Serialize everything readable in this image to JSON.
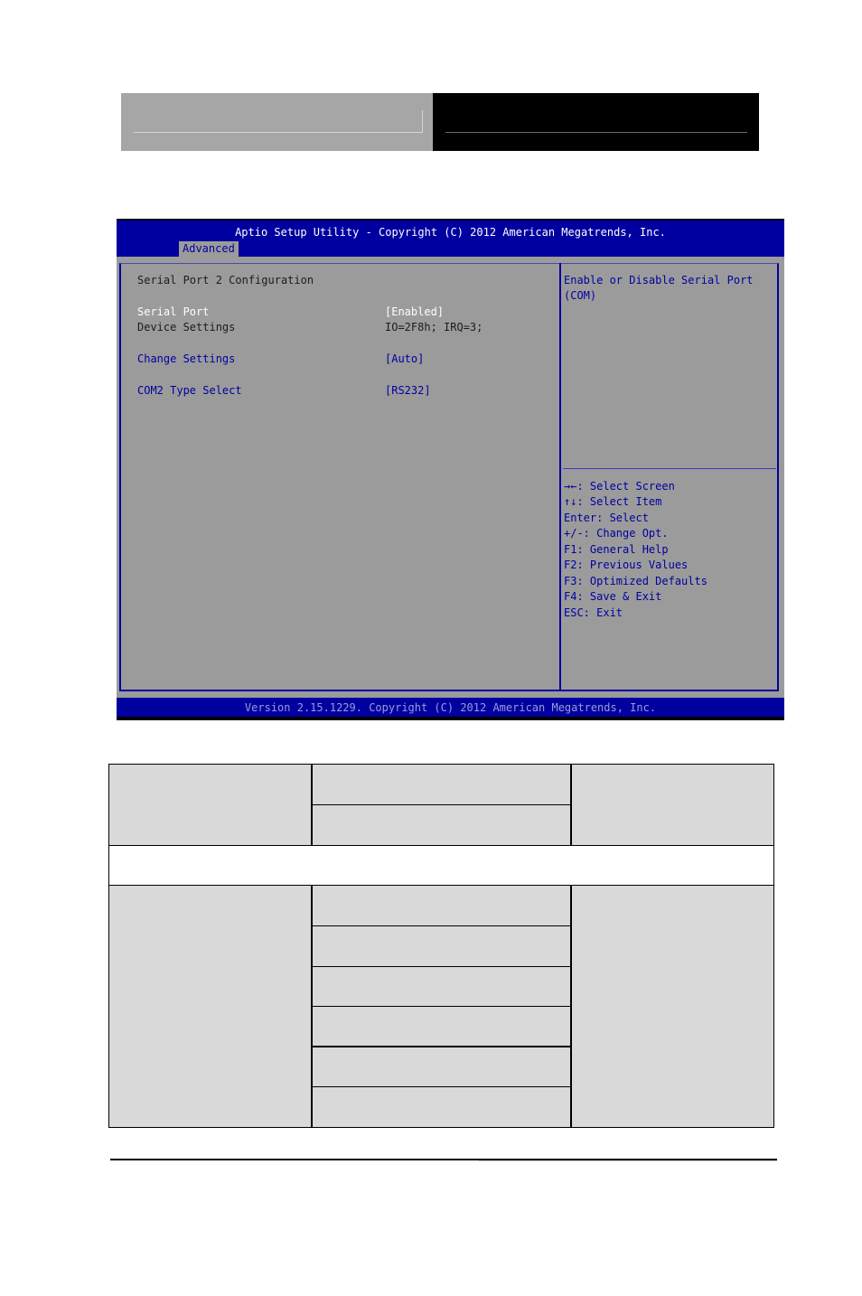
{
  "bios": {
    "title": "Aptio Setup Utility - Copyright (C) 2012 American Megatrends, Inc.",
    "active_tab": "Advanced",
    "section_heading": "Serial Port 2 Configuration",
    "settings": [
      {
        "label": "Serial Port",
        "value": "[Enabled]",
        "state": "selected"
      },
      {
        "label": "Device Settings",
        "value": "IO=2F8h; IRQ=3;",
        "state": "readonly"
      },
      {
        "label": "Change Settings",
        "value": "[Auto]",
        "state": "configurable"
      },
      {
        "label": "COM2 Type Select",
        "value": "[RS232]",
        "state": "configurable"
      }
    ],
    "help_text": [
      "Enable or Disable Serial Port",
      "(COM)"
    ],
    "key_legend": [
      "→←: Select Screen",
      "↑↓: Select Item",
      "Enter: Select",
      "+/-: Change Opt.",
      "F1: General Help",
      "F2: Previous Values",
      "F3: Optimized Defaults",
      "F4: Save & Exit",
      "ESC: Exit"
    ],
    "version": "Version 2.15.1229. Copyright (C) 2012 American Megatrends, Inc.",
    "colors": {
      "bar_blue": "#0000a0",
      "panel_gray": "#9b9b9b",
      "selected_text": "#ffffff",
      "option_text": "#0000a0"
    }
  },
  "doc_table": {
    "rows": [
      {
        "col1": "",
        "col2": [
          "",
          ""
        ],
        "col3": ""
      },
      {
        "span": ""
      },
      {
        "col1": "",
        "col2": [
          "",
          "",
          "",
          "",
          "",
          ""
        ],
        "col3": ""
      }
    ]
  }
}
